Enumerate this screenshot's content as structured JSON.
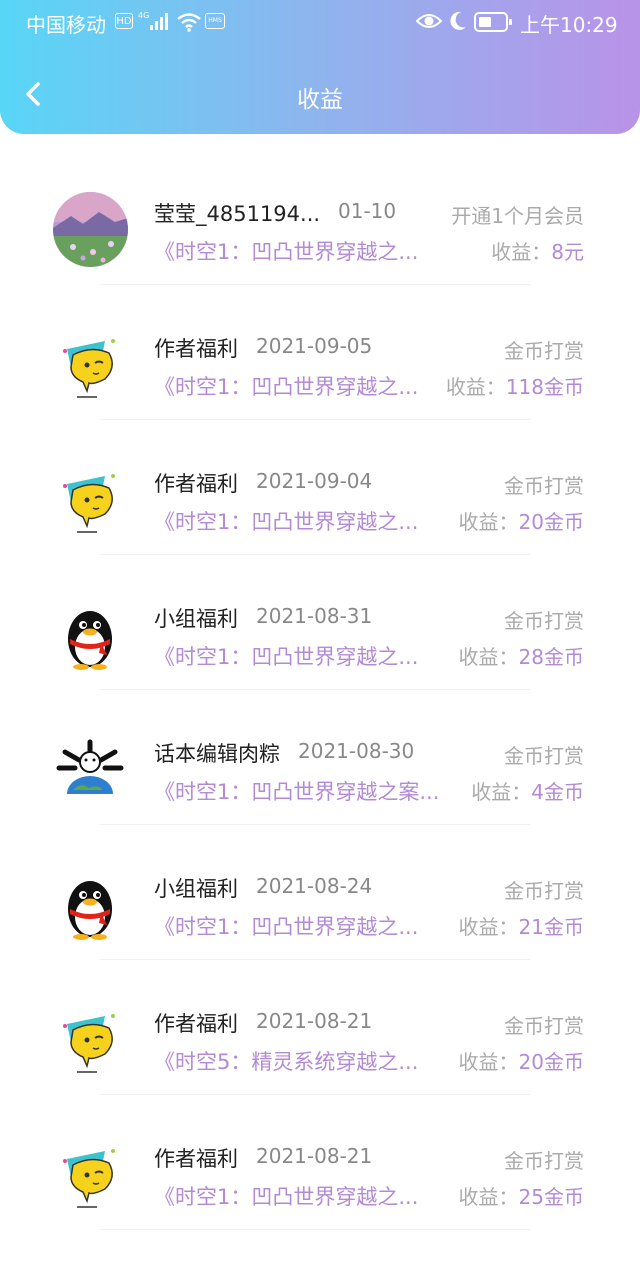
{
  "status_bar": {
    "carrier": "中国移动",
    "hd": "HD",
    "network": "4G",
    "hms": "HMS",
    "time": "上午10:29"
  },
  "nav": {
    "title": "收益"
  },
  "earnings_label": "收益：",
  "items": [
    {
      "avatar": "landscape-photo",
      "name": "莹莹_4851194...",
      "date": "01-10",
      "type": "开通1个月会员",
      "book": "《时空1：凹凸世界穿越之...",
      "amount": "8元"
    },
    {
      "avatar": "yellow-cartoon",
      "name": "作者福利",
      "date": "2021-09-05",
      "type": "金币打赏",
      "book": "《时空1：凹凸世界穿越之...",
      "amount": "118金币"
    },
    {
      "avatar": "yellow-cartoon",
      "name": "作者福利",
      "date": "2021-09-04",
      "type": "金币打赏",
      "book": "《时空1：凹凸世界穿越之...",
      "amount": "20金币"
    },
    {
      "avatar": "penguin",
      "name": "小组福利",
      "date": "2021-08-31",
      "type": "金币打赏",
      "book": "《时空1：凹凸世界穿越之...",
      "amount": "28金币"
    },
    {
      "avatar": "earth-emoji",
      "name": "话本编辑肉粽",
      "date": "2021-08-30",
      "type": "金币打赏",
      "book": "《时空1：凹凸世界穿越之案...",
      "amount": "4金币"
    },
    {
      "avatar": "penguin",
      "name": "小组福利",
      "date": "2021-08-24",
      "type": "金币打赏",
      "book": "《时空1：凹凸世界穿越之...",
      "amount": "21金币"
    },
    {
      "avatar": "yellow-cartoon",
      "name": "作者福利",
      "date": "2021-08-21",
      "type": "金币打赏",
      "book": "《时空5：精灵系统穿越之...",
      "amount": "20金币"
    },
    {
      "avatar": "yellow-cartoon",
      "name": "作者福利",
      "date": "2021-08-21",
      "type": "金币打赏",
      "book": "《时空1：凹凸世界穿越之...",
      "amount": "25金币"
    }
  ]
}
